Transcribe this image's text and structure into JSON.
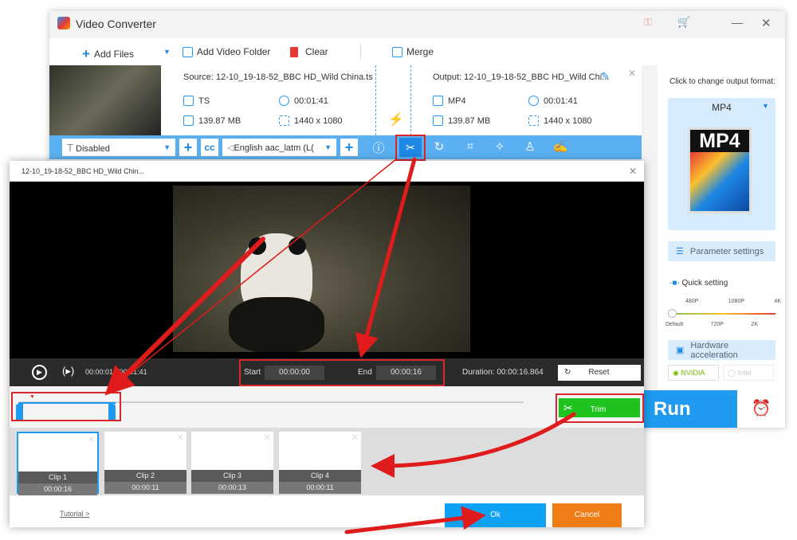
{
  "app": {
    "title": "Video Converter"
  },
  "toolbar": {
    "add_files": "Add Files",
    "add_folder": "Add Video Folder",
    "clear": "Clear",
    "merge": "Merge"
  },
  "file": {
    "source": "Source: 12-10_19-18-52_BBC HD_Wild China.ts",
    "output": "Output: 12-10_19-18-52_BBC HD_Wild Chi...",
    "src_format": "TS",
    "src_duration": "00:01:41",
    "src_size": "139.87 MB",
    "src_resolution": "1440 x 1080",
    "out_format": "MP4",
    "out_duration": "00:01:41",
    "out_size": "139.87 MB",
    "out_resolution": "1440 x 1080"
  },
  "edit_bar": {
    "subtitle": "Disabled",
    "audio": "English aac_latm (L("
  },
  "right_panel": {
    "hint": "Click to change output format:",
    "format": "MP4",
    "format_icon_text": "MP4",
    "param_settings": "Parameter settings",
    "quick_setting": "Quick setting",
    "quality_top": [
      "480P",
      "1080P",
      "4K"
    ],
    "quality_bottom": [
      "Default",
      "720P",
      "2K"
    ],
    "quality_selected": "Default",
    "hw_accel": "Hardware acceleration",
    "nvidia": "NVIDIA",
    "intel": "Intel",
    "run": "Run"
  },
  "trim": {
    "title": "12-10_19-18-52_BBC HD_Wild Chin...",
    "current_time": "00:00:01",
    "total_time": "00:01:41",
    "time_sep": "/",
    "start_label": "Start",
    "start_value": "00:00:00",
    "end_label": "End",
    "end_value": "00:00:16",
    "duration": "Duration: 00:00:16.864",
    "reset": "Reset",
    "trim": "Trim",
    "clips": [
      {
        "name": "Clip 1",
        "duration": "00:00:16"
      },
      {
        "name": "Clip 2",
        "duration": "00:00:11"
      },
      {
        "name": "Clip 3",
        "duration": "00:00:13"
      },
      {
        "name": "Clip 4",
        "duration": "00:00:11"
      }
    ],
    "tutorial": "Tutorial >",
    "ok": "Ok",
    "cancel": "Cancel"
  },
  "colors": {
    "accent": "#1e9bf0",
    "trim_green": "#1ec31e",
    "cancel_orange": "#f07c16",
    "annotation_red": "#d8262c"
  }
}
